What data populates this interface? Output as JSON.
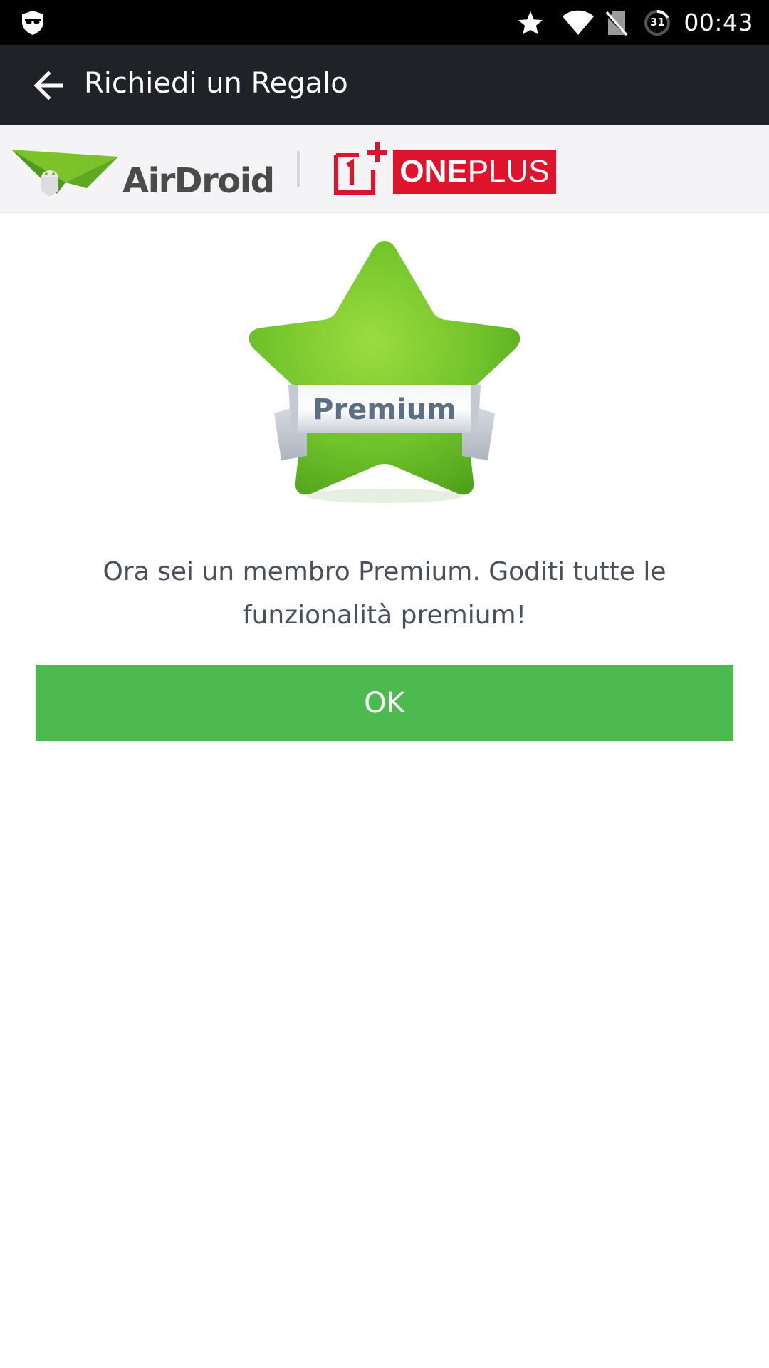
{
  "status_bar": {
    "time": "00:43",
    "battery_level": "31",
    "icons": [
      "shield-mask-icon",
      "star-icon",
      "wifi-icon",
      "no-sim-icon",
      "battery-icon"
    ]
  },
  "app_bar": {
    "back_icon": "arrow-back-icon",
    "title": "Richiedi un Regalo"
  },
  "banner": {
    "airdroid_name": "AirDroid",
    "oneplus_mark": "1+",
    "oneplus_name_prefix": "ONE",
    "oneplus_name_suffix": "PLUS"
  },
  "badge": {
    "label": "Premium",
    "icon": "premium-star-icon"
  },
  "message": {
    "text": "Ora sei un membro Premium. Goditi tutte le funzionalità premium!"
  },
  "ok_button": {
    "label": "OK"
  },
  "colors": {
    "status_bar_bg": "#000000",
    "app_bar_bg": "#202227",
    "banner_bg": "#f4f4f6",
    "accent_green": "#4cba4e",
    "oneplus_red": "#e0132c",
    "message_text": "#4a4f5c"
  }
}
